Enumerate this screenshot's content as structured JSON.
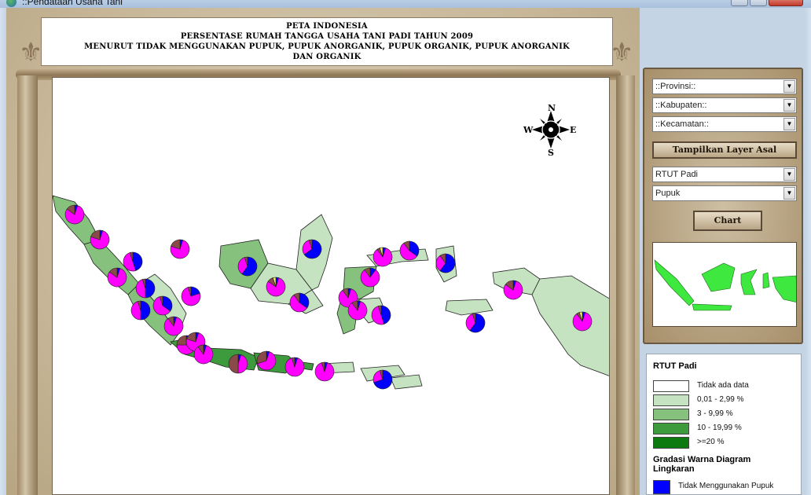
{
  "window": {
    "title": "::Pendataan Usaha Tani"
  },
  "title_card": {
    "line1": "PETA INDONESIA",
    "line2": "PERSENTASE RUMAH TANGGA USAHA TANI PADI TAHUN 2009",
    "line3": "MENURUT TIDAK MENGGUNAKAN PUPUK, PUPUK ANORGANIK, PUPUK ORGANIK, PUPUK ANORGANIK",
    "line4": "DAN ORGANIK"
  },
  "compass": {
    "n": "N",
    "s": "S",
    "e": "E",
    "w": "W"
  },
  "controls": {
    "provinsi": "::Provinsi::",
    "kabupaten": "::Kabupaten::",
    "kecamatan": "::Kecamatan::",
    "tampilkan_label": "Tampilkan Layer Asal",
    "variable": "RTUT Padi",
    "category": "Pupuk",
    "chart_label": "Chart"
  },
  "legend": {
    "title": "RTUT Padi",
    "classes": [
      {
        "label": "Tidak ada data",
        "color": "#ffffff"
      },
      {
        "label": "0,01 - 2,99 %",
        "color": "#c5e3c0"
      },
      {
        "label": "3 - 9,99 %",
        "color": "#86c27e"
      },
      {
        "label": "10 - 19,99 %",
        "color": "#3d9a3d"
      },
      {
        "label": ">=20 %",
        "color": "#0d7a10"
      }
    ],
    "pie_title": "Gradasi Warna Diagram Lingkaran",
    "pie_items": [
      {
        "label": "Tidak Menggunakan Pupuk",
        "color": "#0000ff"
      }
    ]
  },
  "map_colors": {
    "class_0": "#ffffff",
    "class_1": "#c5e3c0",
    "class_2": "#86c27e",
    "class_3": "#3d9a3d",
    "class_4": "#0d7a10",
    "pie_none": "#0000ff",
    "pie_anorganik": "#ff00ff",
    "pie_organik": "#8b4a4a",
    "pie_both": "#f5f06a"
  }
}
